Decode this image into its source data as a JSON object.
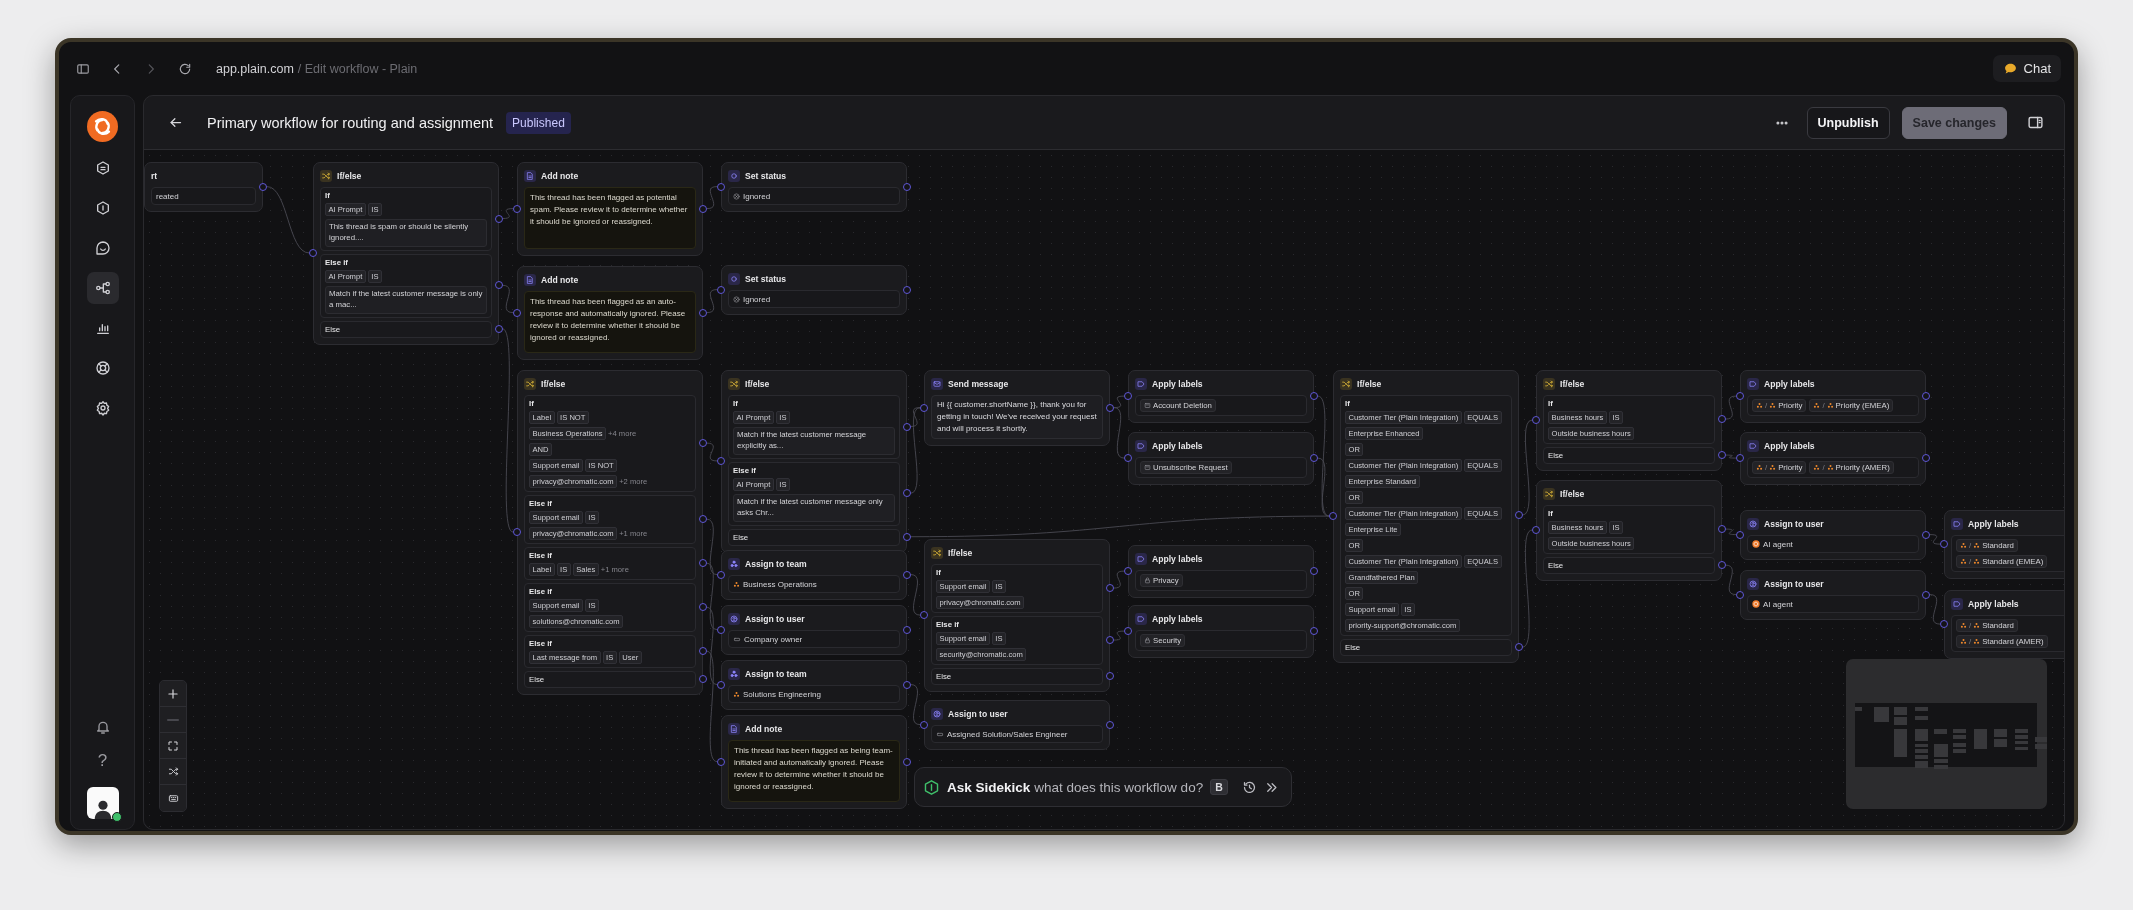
{
  "browser": {
    "host": "app.plain.com",
    "path": "/ Edit workflow - Plain",
    "chat": "Chat"
  },
  "sidebar": {
    "items": [
      {
        "selected": false
      },
      {
        "selected": false
      },
      {
        "selected": false
      },
      {
        "selected": true
      },
      {
        "selected": false
      },
      {
        "selected": false
      },
      {
        "selected": false
      }
    ],
    "help": "?"
  },
  "user": {
    "online": true
  },
  "header": {
    "title": "Primary workflow for routing and assignment",
    "status": "Published",
    "buttons": [
      {
        "label": "Unpublish",
        "disabled": false
      },
      {
        "label": "Save changes",
        "disabled": true
      }
    ]
  },
  "nodes": [
    {
      "kind": "trigger",
      "title": "rt",
      "value": "reated"
    },
    {
      "kind": "ifelse",
      "title": "If/else",
      "branches": [
        {
          "label": "If",
          "lines": [
            {
              "kind": "chips",
              "items": [
                "AI Prompt",
                "IS"
              ]
            },
            {
              "kind": "prompt",
              "text": "This thread is spam or should be silently ignored...."
            }
          ]
        },
        {
          "label": "Else if",
          "lines": [
            {
              "kind": "chips",
              "items": [
                "AI Prompt",
                "IS"
              ]
            },
            {
              "kind": "prompt",
              "text": "Match if the latest customer message is only a mac..."
            }
          ]
        },
        {
          "label": "Else"
        }
      ]
    },
    {
      "kind": "note",
      "title": "Add note",
      "text": "This thread has been flagged as potential spam. Please review it to determine whether it should be ignored or reassigned."
    },
    {
      "kind": "note",
      "title": "Add note",
      "text": "This thread has been flagged as an auto-response and automatically ignored. Please review it to determine whether it should be ignored or reassigned."
    },
    {
      "kind": "ifelse",
      "title": "If/else",
      "branches": [
        {
          "label": "If",
          "lines": [
            {
              "kind": "chips",
              "items": [
                "Label",
                "IS NOT"
              ]
            },
            {
              "kind": "chips",
              "items": [
                "Business Operations"
              ],
              "more": "+4 more"
            },
            {
              "kind": "joiner",
              "text": "AND"
            },
            {
              "kind": "chips",
              "items": [
                "Support email",
                "IS NOT"
              ]
            },
            {
              "kind": "chips",
              "items": [
                "privacy@chromatic.com"
              ],
              "more": "+2 more"
            }
          ]
        },
        {
          "label": "Else if",
          "lines": [
            {
              "kind": "chips",
              "items": [
                "Support email",
                "IS"
              ]
            },
            {
              "kind": "chips",
              "items": [
                "privacy@chromatic.com"
              ],
              "more": "+1 more"
            }
          ]
        },
        {
          "label": "Else if",
          "lines": [
            {
              "kind": "chips",
              "items": [
                "Label",
                "IS",
                "Sales"
              ],
              "more": "+1 more"
            }
          ]
        },
        {
          "label": "Else if",
          "lines": [
            {
              "kind": "chips",
              "items": [
                "Support email",
                "IS"
              ]
            },
            {
              "kind": "chips",
              "items": [
                "solutions@chromatic.com"
              ]
            }
          ]
        },
        {
          "label": "Else if",
          "lines": [
            {
              "kind": "chips",
              "items": [
                "Last message from",
                "IS",
                "User"
              ]
            }
          ]
        },
        {
          "label": "Else"
        }
      ]
    },
    {
      "kind": "status",
      "title": "Set status",
      "value": "Ignored"
    },
    {
      "kind": "status",
      "title": "Set status",
      "value": "Ignored"
    },
    {
      "kind": "ifelse",
      "title": "If/else",
      "branches": [
        {
          "label": "If",
          "lines": [
            {
              "kind": "chips",
              "items": [
                "AI Prompt",
                "IS"
              ]
            },
            {
              "kind": "prompt",
              "text": "Match if the latest customer message explicitly as..."
            }
          ]
        },
        {
          "label": "Else if",
          "lines": [
            {
              "kind": "chips",
              "items": [
                "AI Prompt",
                "IS"
              ]
            },
            {
              "kind": "prompt",
              "text": "Match if the latest customer message only asks Chr..."
            }
          ]
        },
        {
          "label": "Else"
        }
      ]
    },
    {
      "kind": "team",
      "title": "Assign to team",
      "value": "Business Operations"
    },
    {
      "kind": "user",
      "title": "Assign to user",
      "assignee": {
        "kind": "role",
        "name": "Company owner"
      }
    },
    {
      "kind": "team",
      "title": "Assign to team",
      "value": "Solutions Engineering"
    },
    {
      "kind": "note",
      "title": "Add note",
      "text": "This thread has been flagged as being team-initiated and automatically ignored. Please review it to determine whether it should be ignored or reassigned."
    },
    {
      "kind": "message",
      "title": "Send message",
      "text": "Hi {{ customer.shortName }}, thank you for getting in touch! We've received your request and will process it shortly."
    },
    {
      "kind": "ifelse",
      "title": "If/else",
      "branches": [
        {
          "label": "If",
          "lines": [
            {
              "kind": "chips",
              "items": [
                "Support email",
                "IS"
              ]
            },
            {
              "kind": "chips",
              "items": [
                "privacy@chromatic.com"
              ]
            }
          ]
        },
        {
          "label": "Else if",
          "lines": [
            {
              "kind": "chips",
              "items": [
                "Support email",
                "IS"
              ]
            },
            {
              "kind": "chips",
              "items": [
                "security@chromatic.com"
              ]
            }
          ]
        },
        {
          "label": "Else"
        }
      ]
    },
    {
      "kind": "user",
      "title": "Assign to user",
      "assignee": {
        "kind": "role",
        "name": "Assigned Solution/Sales Engineer"
      }
    },
    {
      "kind": "labels",
      "title": "Apply labels",
      "labels": [
        {
          "kind": "tag",
          "text": "Account Deletion"
        }
      ]
    },
    {
      "kind": "labels",
      "title": "Apply labels",
      "labels": [
        {
          "kind": "tag",
          "text": "Unsubscribe Request"
        }
      ]
    },
    {
      "kind": "labels",
      "title": "Apply labels",
      "labels": [
        {
          "kind": "lock",
          "text": "Privacy"
        }
      ]
    },
    {
      "kind": "labels",
      "title": "Apply labels",
      "labels": [
        {
          "kind": "lock",
          "text": "Security"
        }
      ]
    },
    {
      "kind": "ifelse",
      "title": "If/else",
      "branches": [
        {
          "label": "If",
          "lines": [
            {
              "kind": "chips",
              "items": [
                "Customer Tier (Plain Integration)",
                "EQUALS"
              ]
            },
            {
              "kind": "chips",
              "items": [
                "Enterprise Enhanced"
              ]
            },
            {
              "kind": "joiner",
              "text": "OR"
            },
            {
              "kind": "chips",
              "items": [
                "Customer Tier (Plain Integration)",
                "EQUALS"
              ]
            },
            {
              "kind": "chips",
              "items": [
                "Enterprise Standard"
              ]
            },
            {
              "kind": "joiner",
              "text": "OR"
            },
            {
              "kind": "chips",
              "items": [
                "Customer Tier (Plain Integration)",
                "EQUALS"
              ]
            },
            {
              "kind": "chips",
              "items": [
                "Enterprise Lite"
              ]
            },
            {
              "kind": "joiner",
              "text": "OR"
            },
            {
              "kind": "chips",
              "items": [
                "Customer Tier (Plain Integration)",
                "EQUALS"
              ]
            },
            {
              "kind": "chips",
              "items": [
                "Grandfathered Plan"
              ]
            },
            {
              "kind": "joiner",
              "text": "OR"
            },
            {
              "kind": "chips",
              "items": [
                "Support email",
                "IS"
              ]
            },
            {
              "kind": "chips",
              "items": [
                "priority-support@chromatic.com"
              ]
            }
          ]
        },
        {
          "label": "Else"
        }
      ]
    },
    {
      "kind": "ifelse",
      "title": "If/else",
      "branches": [
        {
          "label": "If",
          "lines": [
            {
              "kind": "chips",
              "items": [
                "Business hours",
                "IS"
              ]
            },
            {
              "kind": "chips",
              "items": [
                "Outside business hours"
              ]
            }
          ]
        },
        {
          "label": "Else"
        }
      ]
    },
    {
      "kind": "ifelse",
      "title": "If/else",
      "branches": [
        {
          "label": "If",
          "lines": [
            {
              "kind": "chips",
              "items": [
                "Business hours",
                "IS"
              ]
            },
            {
              "kind": "chips",
              "items": [
                "Outside business hours"
              ]
            }
          ]
        },
        {
          "label": "Else"
        }
      ]
    },
    {
      "kind": "labels",
      "title": "Apply labels",
      "labels": [
        {
          "kind": "tiered",
          "separator": "/",
          "text": "Priority"
        },
        {
          "kind": "tiered",
          "separator": "/",
          "text": "Priority (EMEA)"
        }
      ]
    },
    {
      "kind": "labels",
      "title": "Apply labels",
      "labels": [
        {
          "kind": "tiered",
          "separator": "/",
          "text": "Priority"
        },
        {
          "kind": "tiered",
          "separator": "/",
          "text": "Priority (AMER)"
        }
      ]
    },
    {
      "kind": "user",
      "title": "Assign to user",
      "assignee": {
        "kind": "agent",
        "name": "AI agent"
      }
    },
    {
      "kind": "user",
      "title": "Assign to user",
      "assignee": {
        "kind": "agent",
        "name": "AI agent"
      }
    },
    {
      "kind": "labels",
      "title": "Apply labels",
      "labels": [
        {
          "kind": "tiered",
          "separator": "/",
          "text": "Standard"
        },
        {
          "kind": "tiered",
          "separator": "/",
          "text": "Standard (EMEA)"
        }
      ]
    },
    {
      "kind": "labels",
      "title": "Apply labels",
      "labels": [
        {
          "kind": "tiered",
          "separator": "/",
          "text": "Standard"
        },
        {
          "kind": "tiered",
          "separator": "/",
          "text": "Standard (AMER)"
        }
      ]
    }
  ],
  "sidekick": {
    "title": "Ask Sidekick",
    "prompt": "what does this workflow do?",
    "shortcut": "B"
  }
}
